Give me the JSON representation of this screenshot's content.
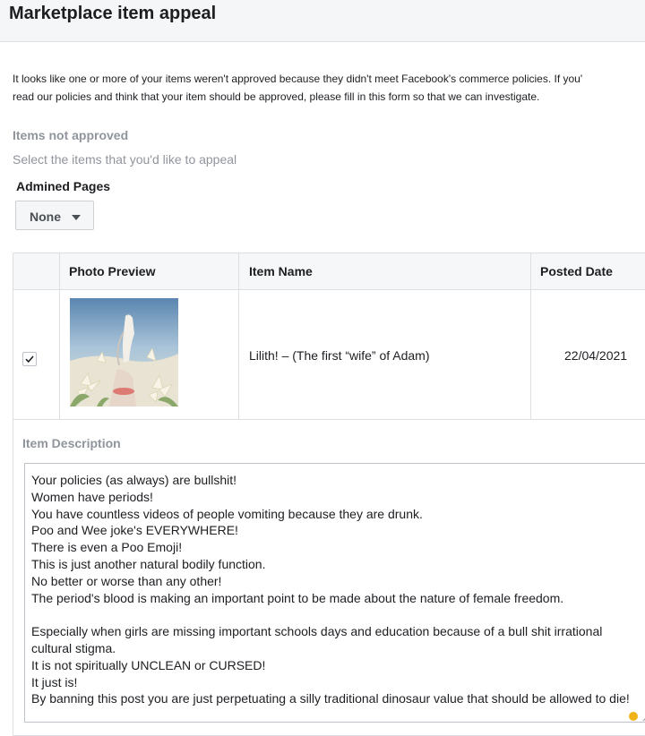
{
  "header": {
    "title": "Marketplace item appeal"
  },
  "intro": {
    "line1": "It looks like one or more of your items weren't approved because they didn't meet Facebook's commerce policies. If you'",
    "line2": "read our policies and think that your item should be approved, please fill in this form so that we can investigate."
  },
  "items_section": {
    "title": "Items not approved",
    "subtitle": "Select the items that you'd like to appeal"
  },
  "pages_filter": {
    "label": "Admined Pages",
    "selected": "None"
  },
  "table": {
    "columns": [
      "Photo Preview",
      "Item Name",
      "Posted Date"
    ],
    "rows": [
      {
        "checked": true,
        "item_name": "Lilith! – (The first “wife” of Adam)",
        "posted_date": "22/04/2021"
      }
    ]
  },
  "description": {
    "label": "Item Description",
    "text": "Your policies (as always) are bullshit!\nWomen have periods!\nYou have countless videos of people vomiting because they are drunk.\nPoo and Wee joke's EVERYWHERE!\nThere is even a Poo Emoji!\nThis is just another natural bodily function.\nNo better or worse than any other!\nThe period's blood is making an important point to be made about the nature of female freedom.\n\nEspecially when girls are missing important schools days and education because of a bull shit irrational cultural stigma.\nIt is not spiritually UNCLEAN or CURSED!\nIt just is!\nBy banning this post you are just perpetuating a silly traditional dinosaur value that should be allowed to die!"
  },
  "icons": {
    "dropdown": "caret-down-icon",
    "check": "check-icon",
    "resize": "resize-handle-icon"
  },
  "colors": {
    "header_bg": "#f5f6f7",
    "muted_text": "#90949c",
    "border": "#dddfe2",
    "status_dot": "#f0b31a"
  }
}
